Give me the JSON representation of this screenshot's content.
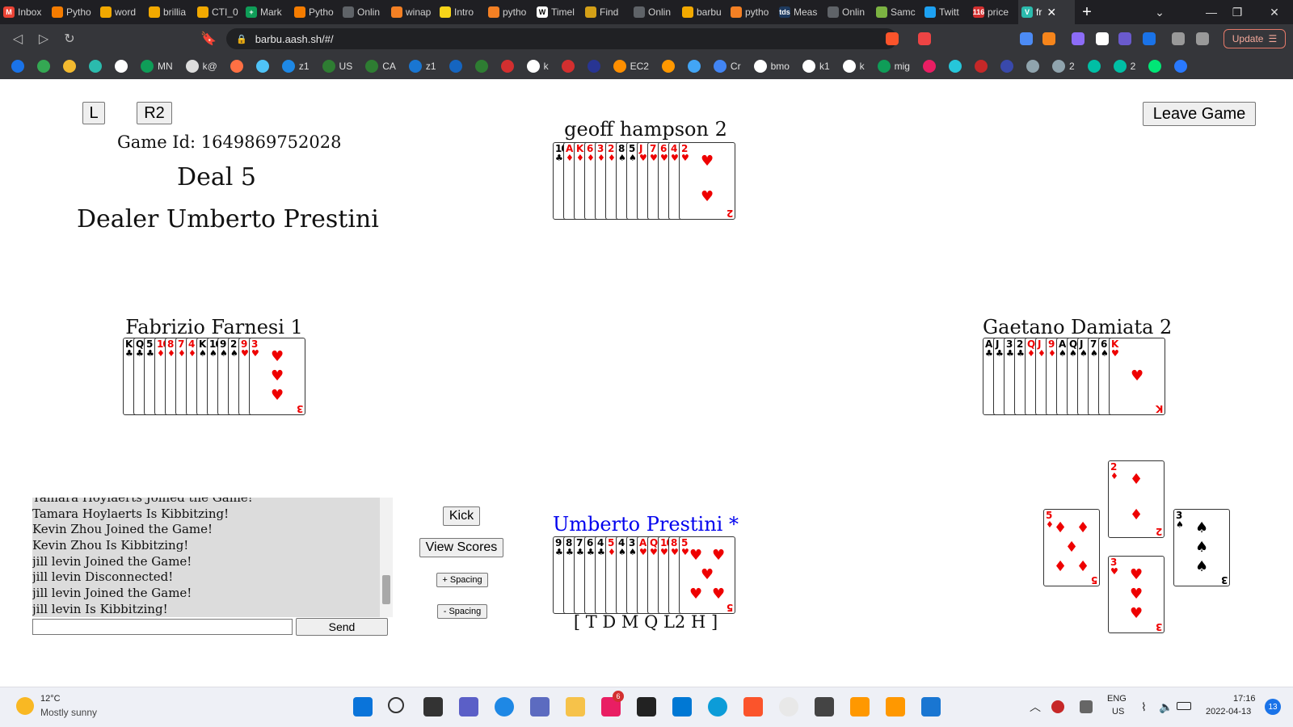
{
  "browser": {
    "tabs": [
      {
        "label": "Inbox",
        "color": "#ea4335",
        "glyph": "M"
      },
      {
        "label": "Pytho",
        "color": "#f57c00",
        "glyph": ""
      },
      {
        "label": "word",
        "color": "#f2a900",
        "glyph": ""
      },
      {
        "label": "brillia",
        "color": "#f2a900",
        "glyph": ""
      },
      {
        "label": "CTI_0",
        "color": "#f2a900",
        "glyph": ""
      },
      {
        "label": "Mark",
        "color": "#0f9d58",
        "glyph": "+"
      },
      {
        "label": "Pytho",
        "color": "#f57c00",
        "glyph": ""
      },
      {
        "label": "Onlin",
        "color": "#5f6368",
        "glyph": ""
      },
      {
        "label": "winap",
        "color": "#f48024",
        "glyph": ""
      },
      {
        "label": "Intro",
        "color": "#f7d419",
        "glyph": ""
      },
      {
        "label": "pytho",
        "color": "#f48024",
        "glyph": ""
      },
      {
        "label": "Timel",
        "color": "#ffffff",
        "glyph": "W"
      },
      {
        "label": "Find",
        "color": "#d4a017",
        "glyph": ""
      },
      {
        "label": "Onlin",
        "color": "#5f6368",
        "glyph": ""
      },
      {
        "label": "barbu",
        "color": "#f2a900",
        "glyph": ""
      },
      {
        "label": "pytho",
        "color": "#f48024",
        "glyph": ""
      },
      {
        "label": "Meas",
        "color": "#1e3a5f",
        "glyph": "tds"
      },
      {
        "label": "Onlin",
        "color": "#5f6368",
        "glyph": ""
      },
      {
        "label": "Samc",
        "color": "#7cb342",
        "glyph": ""
      },
      {
        "label": "Twitt",
        "color": "#1da1f2",
        "glyph": ""
      },
      {
        "label": "price",
        "color": "#d32f2f",
        "glyph": "116"
      }
    ],
    "active_tab": {
      "label": "fr",
      "color": "#2bbbad",
      "glyph": "V"
    },
    "url": "barbu.aash.sh/#/",
    "update_label": "Update",
    "bookmarks": [
      {
        "label": "",
        "color": "#1a73e8"
      },
      {
        "label": "",
        "color": "#34a853"
      },
      {
        "label": "",
        "color": "#f3ba2f"
      },
      {
        "label": "",
        "color": "#2bbbad"
      },
      {
        "label": "",
        "color": "#ffffff"
      },
      {
        "label": "MN",
        "color": "#0f9d58"
      },
      {
        "label": "k@",
        "color": "#dddddd"
      },
      {
        "label": "",
        "color": "#ff7043"
      },
      {
        "label": "",
        "color": "#4fc3f7"
      },
      {
        "label": "z1",
        "color": "#1e88e5"
      },
      {
        "label": "US",
        "color": "#2e7d32"
      },
      {
        "label": "CA",
        "color": "#2e7d32"
      },
      {
        "label": "z1",
        "color": "#1976d2"
      },
      {
        "label": "",
        "color": "#1565c0"
      },
      {
        "label": "",
        "color": "#2e7d32"
      },
      {
        "label": "",
        "color": "#d32f2f"
      },
      {
        "label": "k",
        "color": "#ffffff"
      },
      {
        "label": "",
        "color": "#d32f2f"
      },
      {
        "label": "",
        "color": "#283593"
      },
      {
        "label": "EC2",
        "color": "#ff8f00"
      },
      {
        "label": "",
        "color": "#ff9800"
      },
      {
        "label": "",
        "color": "#42a5f5"
      },
      {
        "label": "Cr",
        "color": "#4285f4"
      },
      {
        "label": "bmo",
        "color": "#ffffff"
      },
      {
        "label": "k1",
        "color": "#ffffff"
      },
      {
        "label": "k",
        "color": "#ffffff"
      },
      {
        "label": "mig",
        "color": "#0f9d58"
      },
      {
        "label": "",
        "color": "#e91e63"
      },
      {
        "label": "",
        "color": "#26c6da"
      },
      {
        "label": "",
        "color": "#c62828"
      },
      {
        "label": "",
        "color": "#3949ab"
      },
      {
        "label": "",
        "color": "#90a4ae"
      },
      {
        "label": "2",
        "color": "#90a4ae"
      },
      {
        "label": "",
        "color": "#00bfa5"
      },
      {
        "label": "2",
        "color": "#00bfa5"
      },
      {
        "label": "",
        "color": "#00e676"
      },
      {
        "label": "",
        "color": "#2979ff"
      }
    ]
  },
  "game": {
    "left_button": "L",
    "r2_button": "R2",
    "leave_button": "Leave Game",
    "game_id": "Game Id: 1649869752028",
    "deal": "Deal 5",
    "dealer": "Dealer Umberto Prestini",
    "players": {
      "north": {
        "name": "geoff hampson 2",
        "cards": [
          {
            "r": "10",
            "s": "♣",
            "c": "black"
          },
          {
            "r": "A",
            "s": "♦",
            "c": "red"
          },
          {
            "r": "K",
            "s": "♦",
            "c": "red"
          },
          {
            "r": "6",
            "s": "♦",
            "c": "red"
          },
          {
            "r": "3",
            "s": "♦",
            "c": "red"
          },
          {
            "r": "2",
            "s": "♦",
            "c": "red"
          },
          {
            "r": "8",
            "s": "♠",
            "c": "black"
          },
          {
            "r": "5",
            "s": "♠",
            "c": "black"
          },
          {
            "r": "J",
            "s": "♥",
            "c": "red"
          },
          {
            "r": "7",
            "s": "♥",
            "c": "red"
          },
          {
            "r": "6",
            "s": "♥",
            "c": "red"
          },
          {
            "r": "4",
            "s": "♥",
            "c": "red"
          },
          {
            "r": "2",
            "s": "♥",
            "c": "red"
          }
        ]
      },
      "west": {
        "name": "Fabrizio Farnesi 1",
        "cards": [
          {
            "r": "K",
            "s": "♣",
            "c": "black"
          },
          {
            "r": "Q",
            "s": "♣",
            "c": "black"
          },
          {
            "r": "5",
            "s": "♣",
            "c": "black"
          },
          {
            "r": "10",
            "s": "♦",
            "c": "red"
          },
          {
            "r": "8",
            "s": "♦",
            "c": "red"
          },
          {
            "r": "7",
            "s": "♦",
            "c": "red"
          },
          {
            "r": "4",
            "s": "♦",
            "c": "red"
          },
          {
            "r": "K",
            "s": "♠",
            "c": "black"
          },
          {
            "r": "10",
            "s": "♠",
            "c": "black"
          },
          {
            "r": "9",
            "s": "♠",
            "c": "black"
          },
          {
            "r": "2",
            "s": "♠",
            "c": "black"
          },
          {
            "r": "9",
            "s": "♥",
            "c": "red"
          },
          {
            "r": "3",
            "s": "♥",
            "c": "red"
          }
        ]
      },
      "east": {
        "name": "Gaetano Damiata 2",
        "cards": [
          {
            "r": "A",
            "s": "♣",
            "c": "black"
          },
          {
            "r": "J",
            "s": "♣",
            "c": "black"
          },
          {
            "r": "3",
            "s": "♣",
            "c": "black"
          },
          {
            "r": "2",
            "s": "♣",
            "c": "black"
          },
          {
            "r": "Q",
            "s": "♦",
            "c": "red"
          },
          {
            "r": "J",
            "s": "♦",
            "c": "red"
          },
          {
            "r": "9",
            "s": "♦",
            "c": "red"
          },
          {
            "r": "A",
            "s": "♠",
            "c": "black"
          },
          {
            "r": "Q",
            "s": "♠",
            "c": "black"
          },
          {
            "r": "J",
            "s": "♠",
            "c": "black"
          },
          {
            "r": "7",
            "s": "♠",
            "c": "black"
          },
          {
            "r": "6",
            "s": "♠",
            "c": "black"
          },
          {
            "r": "K",
            "s": "♥",
            "c": "red"
          }
        ]
      },
      "south": {
        "name": "Umberto Prestini *",
        "contracts": "[ T D M Q L2 H ]",
        "cards": [
          {
            "r": "9",
            "s": "♣",
            "c": "black"
          },
          {
            "r": "8",
            "s": "♣",
            "c": "black"
          },
          {
            "r": "7",
            "s": "♣",
            "c": "black"
          },
          {
            "r": "6",
            "s": "♣",
            "c": "black"
          },
          {
            "r": "4",
            "s": "♣",
            "c": "black"
          },
          {
            "r": "5",
            "s": "♦",
            "c": "red"
          },
          {
            "r": "4",
            "s": "♠",
            "c": "black"
          },
          {
            "r": "3",
            "s": "♠",
            "c": "black"
          },
          {
            "r": "A",
            "s": "♥",
            "c": "red"
          },
          {
            "r": "Q",
            "s": "♥",
            "c": "red"
          },
          {
            "r": "10",
            "s": "♥",
            "c": "red"
          },
          {
            "r": "8",
            "s": "♥",
            "c": "red"
          },
          {
            "r": "5",
            "s": "♥",
            "c": "red"
          }
        ]
      }
    },
    "trick": {
      "north": {
        "r": "2",
        "s": "♦",
        "c": "red"
      },
      "west": {
        "r": "5",
        "s": "♦",
        "c": "red"
      },
      "east": {
        "r": "3",
        "s": "♠",
        "c": "black"
      },
      "south": {
        "r": "3",
        "s": "♥",
        "c": "red"
      }
    },
    "chat": [
      "Tamara Hoylaerts Joined the Game!",
      "Tamara Hoylaerts Is Kibbitzing!",
      "Kevin Zhou Joined the Game!",
      "Kevin Zhou Is Kibbitzing!",
      "jill levin Joined the Game!",
      "jill levin Disconnected!",
      "jill levin Joined the Game!",
      "jill levin Is Kibbitzing!"
    ],
    "send_button": "Send",
    "kick_button": "Kick",
    "view_scores_button": "View Scores",
    "plus_spacing_button": "+ Spacing",
    "minus_spacing_button": "- Spacing"
  },
  "taskbar": {
    "weather_temp": "12°C",
    "weather_desc": "Mostly sunny",
    "lang": "ENG",
    "region": "US",
    "time": "17:16",
    "date": "2022-04-13",
    "notifications": "13",
    "store_badge": "6"
  }
}
